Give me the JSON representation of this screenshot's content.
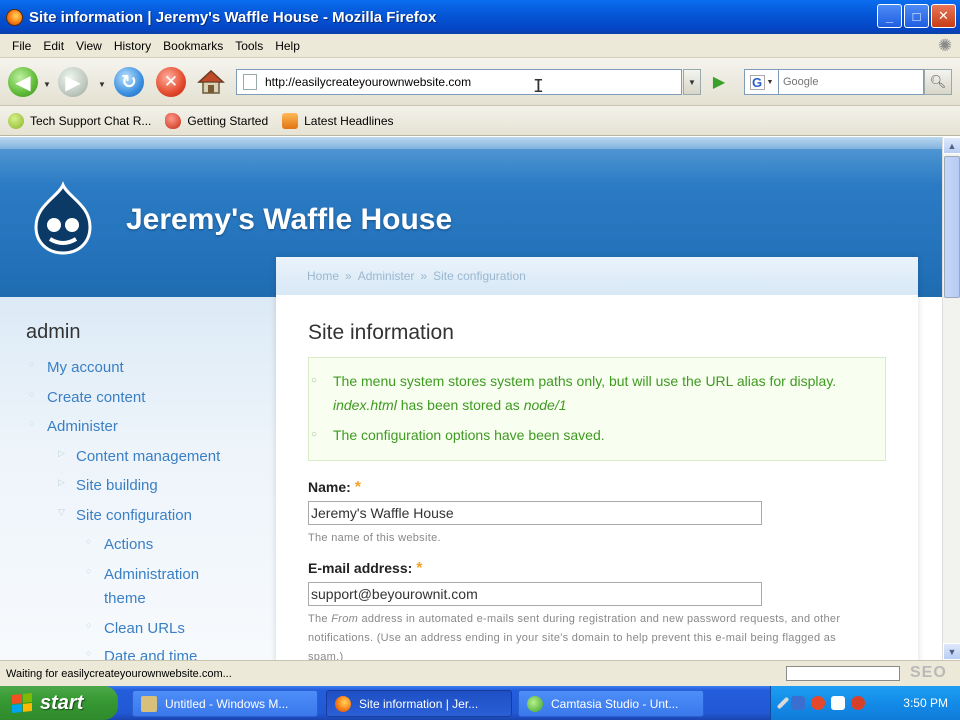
{
  "window": {
    "title": "Site information | Jeremy's Waffle House - Mozilla Firefox",
    "buttons": {
      "minimize": "_",
      "maximize": "□",
      "close": "✕"
    }
  },
  "menu": [
    "File",
    "Edit",
    "View",
    "History",
    "Bookmarks",
    "Tools",
    "Help"
  ],
  "toolbar": {
    "url": "http://easilycreateyourownwebsite.com",
    "search_placeholder": "Google",
    "search_engine_letter": "G"
  },
  "bookmarks": [
    "Tech Support Chat R...",
    "Getting Started",
    "Latest Headlines"
  ],
  "page": {
    "site_name": "Jeremy's Waffle House",
    "breadcrumb": [
      "Home",
      "»",
      "Administer",
      "»",
      "Site configuration"
    ],
    "title": "Site information",
    "messages": {
      "m1_prefix": "The menu system stores system paths only, but will use the URL alias for display. ",
      "m1_em1": "index.html",
      "m1_mid": " has been stored as ",
      "m1_em2": "node/1",
      "m2": "The configuration options have been saved."
    },
    "form": {
      "name_label": "Name:",
      "required_mark": "*",
      "name_value": "Jeremy's Waffle House",
      "name_desc": "The name of this website.",
      "email_label": "E-mail address:",
      "email_value": "support@beyourownit.com",
      "email_desc_prefix": "The ",
      "email_desc_em": "From",
      "email_desc_rest": " address in automated e-mails sent during registration and new password requests, and other notifications. (Use an address ending in your site's domain to help prevent this e-mail being flagged as spam.)"
    },
    "left_nav": {
      "user": "admin",
      "items": {
        "my_account": "My account",
        "create_content": "Create content",
        "administer": "Administer",
        "content_management": "Content management",
        "site_building": "Site building",
        "site_configuration": "Site configuration",
        "actions": "Actions",
        "administration_theme_1": "Administration",
        "administration_theme_2": "theme",
        "clean_urls": "Clean URLs",
        "date_and_time": "Date and time"
      }
    }
  },
  "status": {
    "text": "Waiting for easilycreateyourownwebsite.com...",
    "watermark": "SEO"
  },
  "taskbar": {
    "start": "start",
    "tasks": [
      "Untitled - Windows M...",
      "Site information | Jer...",
      "Camtasia Studio - Unt..."
    ],
    "clock": "3:50 PM"
  }
}
